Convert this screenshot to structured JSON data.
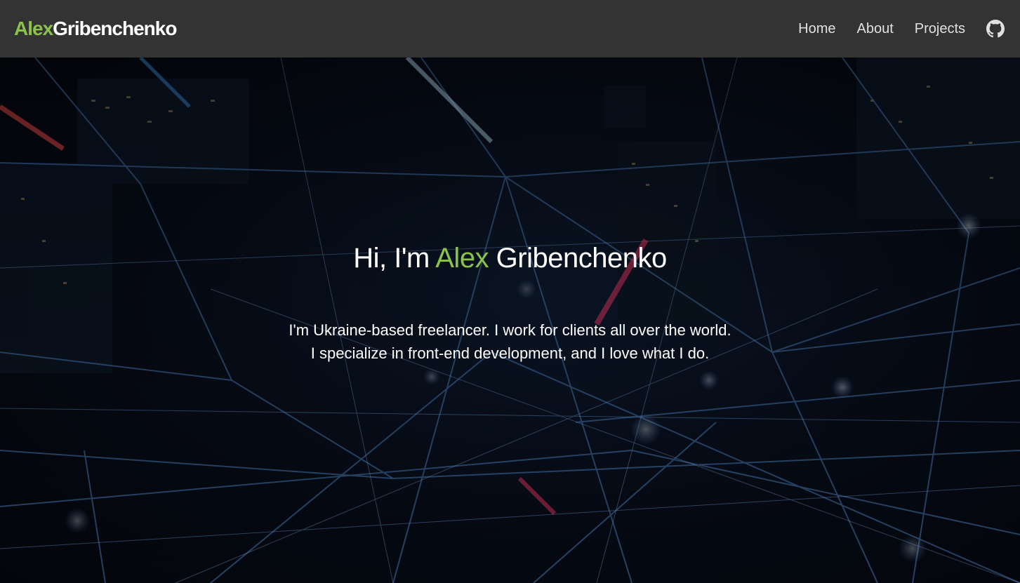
{
  "header": {
    "logo_first": "Alex",
    "logo_last": "Gribenchenko",
    "nav": [
      {
        "label": "Home"
      },
      {
        "label": "About"
      },
      {
        "label": "Projects"
      }
    ],
    "github_icon": "github-icon"
  },
  "hero": {
    "greeting": "Hi, I'm ",
    "first_name": "Alex",
    "last_name": " Gribenchenko",
    "line1": "I'm Ukraine-based freelancer. I work for clients all over the world.",
    "line2": "I specialize in front-end development, and I love what I do."
  },
  "colors": {
    "accent": "#8bc34a",
    "navbar": "#333333",
    "text": "#ffffff"
  }
}
